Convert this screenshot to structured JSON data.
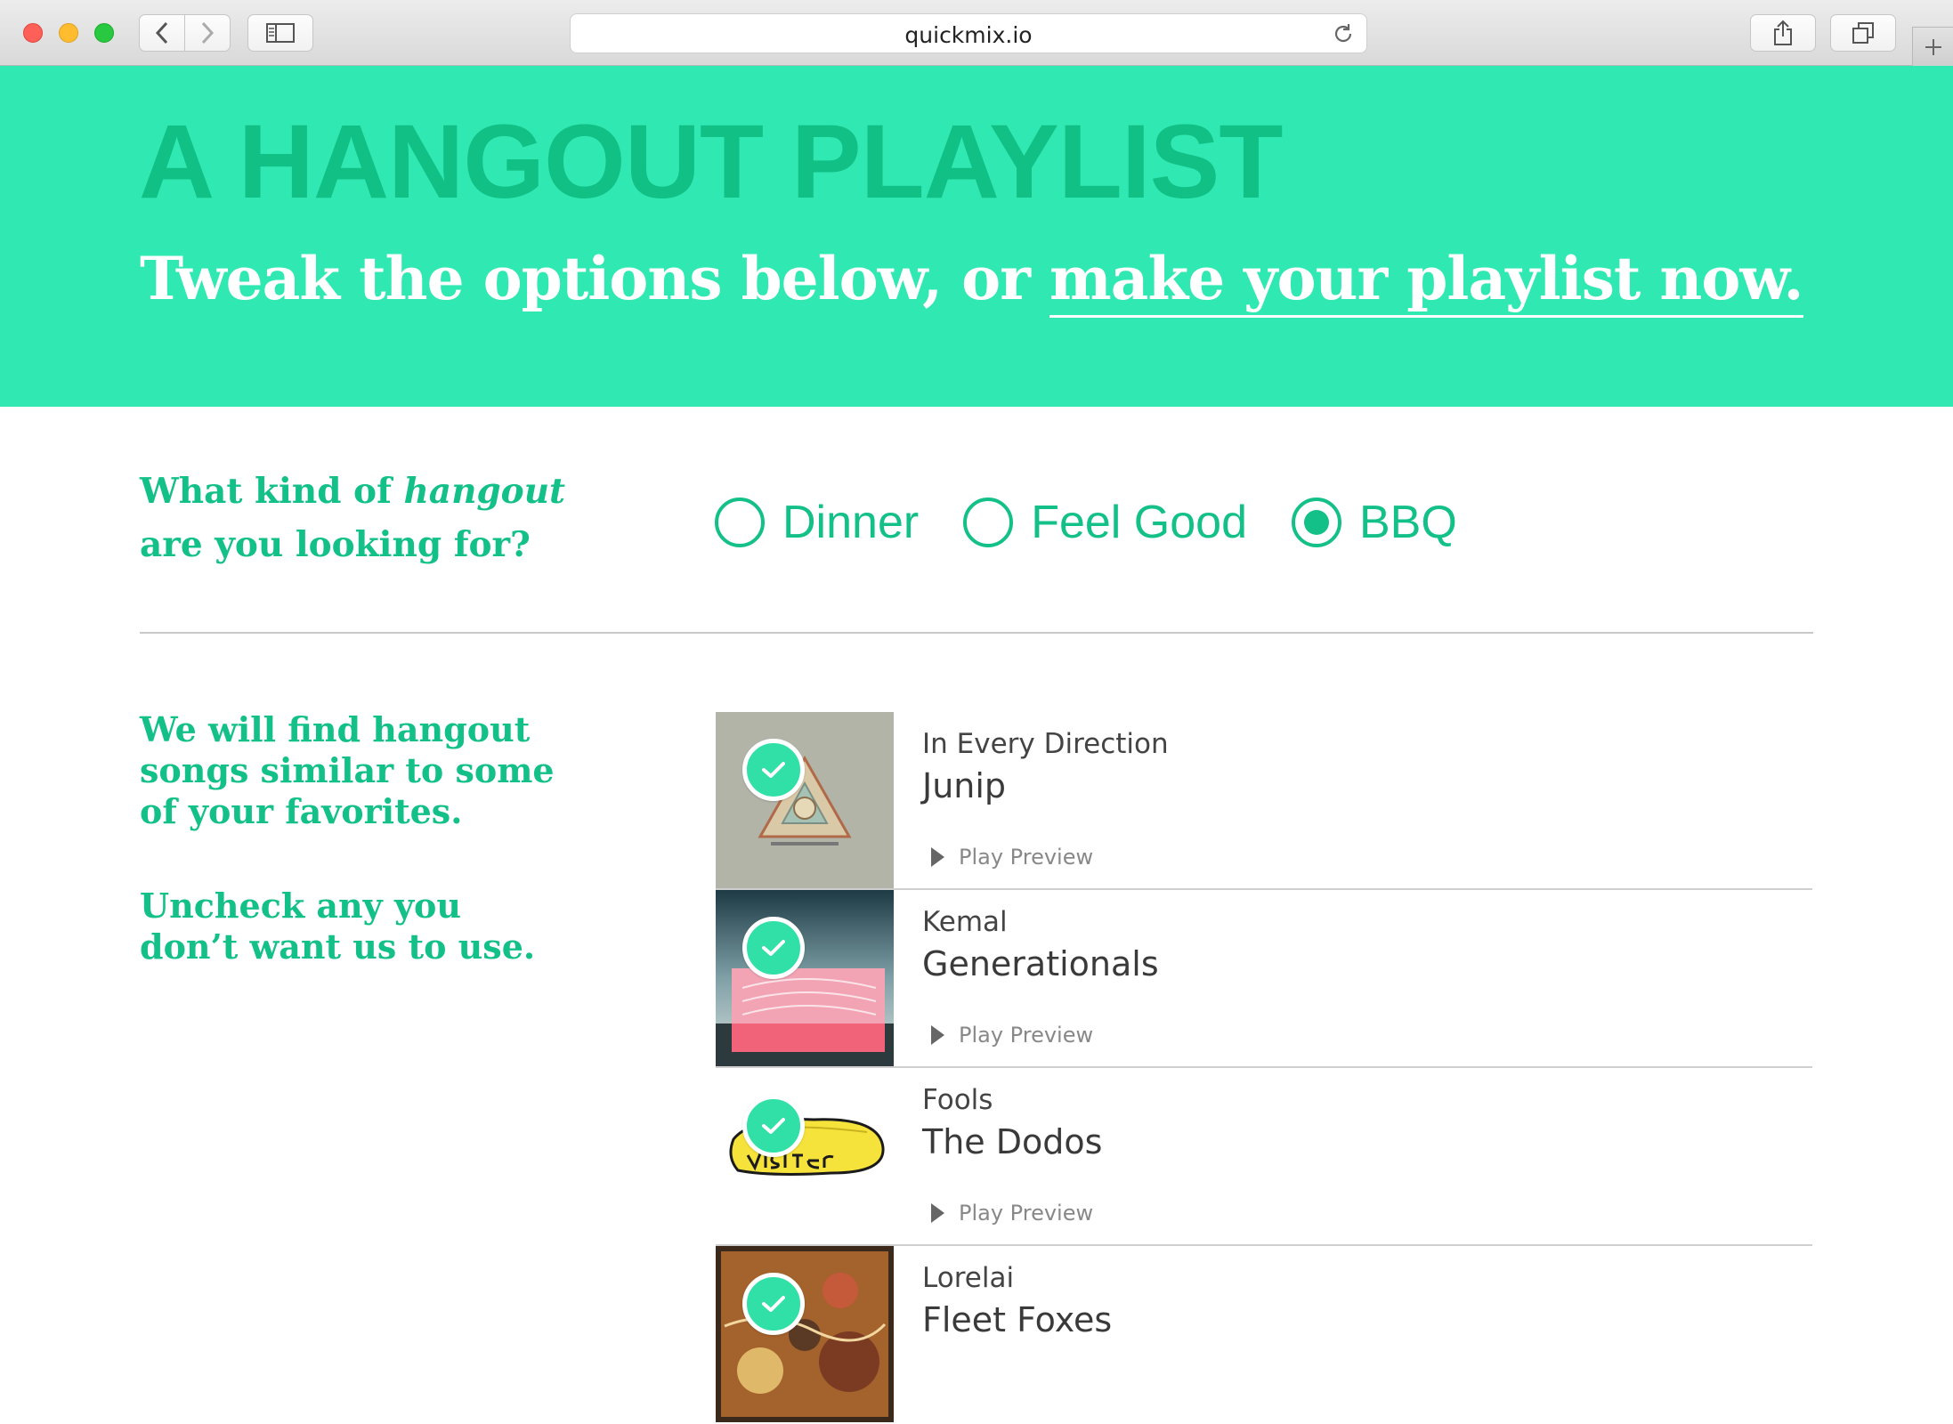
{
  "browser": {
    "url": "quickmix.io"
  },
  "hero": {
    "title": "A HANGOUT PLAYLIST",
    "subtitle_prefix": "Tweak the options below, or ",
    "subtitle_link": "make your playlist now."
  },
  "question": {
    "line1_prefix": "What kind of ",
    "line1_em": "hangout",
    "line2": "are you looking for?"
  },
  "hangout_options": [
    {
      "label": "Dinner",
      "selected": false
    },
    {
      "label": "Feel Good",
      "selected": false
    },
    {
      "label": "BBQ",
      "selected": true
    }
  ],
  "description": {
    "line1": "We will find hangout",
    "line2": "songs similar to some",
    "line3": "of your favorites.",
    "line4": "Uncheck any you",
    "line5": "don’t want us to use."
  },
  "songs": [
    {
      "title": "In Every Direction",
      "artist": "Junip",
      "preview": "Play Preview",
      "checked": true
    },
    {
      "title": "Kemal",
      "artist": "Generationals",
      "preview": "Play Preview",
      "checked": true
    },
    {
      "title": "Fools",
      "artist": "The Dodos",
      "preview": "Play Preview",
      "checked": true
    },
    {
      "title": "Lorelai",
      "artist": "Fleet Foxes",
      "preview": "",
      "checked": true
    }
  ],
  "colors": {
    "accent": "#13c088",
    "hero_bg": "#30e8b2",
    "title_color": "#11c084",
    "check_bg": "#30e0a6"
  }
}
